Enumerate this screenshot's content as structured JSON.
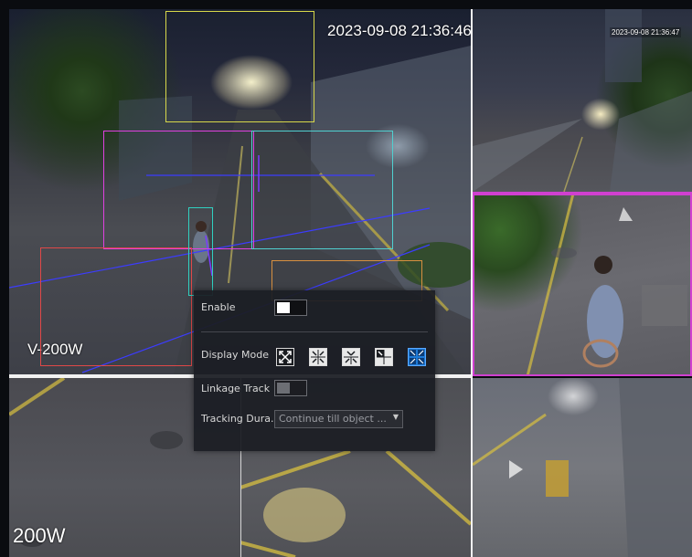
{
  "main_camera": {
    "timestamp": "2023-09-08 21:36:46",
    "channel_name": "V-200W"
  },
  "top_right_camera": {
    "timestamp": "2023-09-08 21:36:47"
  },
  "bottom_left_camera": {
    "channel_name": "200W"
  },
  "settings_panel": {
    "enable_label": "Enable",
    "enable_state": true,
    "display_mode_label": "Display Mode",
    "display_modes": [
      "single",
      "quad-cross",
      "split-horizontal",
      "three-split",
      "quad-grid"
    ],
    "display_mode_selected_index": 4,
    "linkage_track_label": "Linkage Track",
    "linkage_track_state": false,
    "tracking_duration_label": "Tracking Dura...",
    "tracking_duration_value": "Continue till object ...",
    "accent_color": "#1e7ad6"
  }
}
